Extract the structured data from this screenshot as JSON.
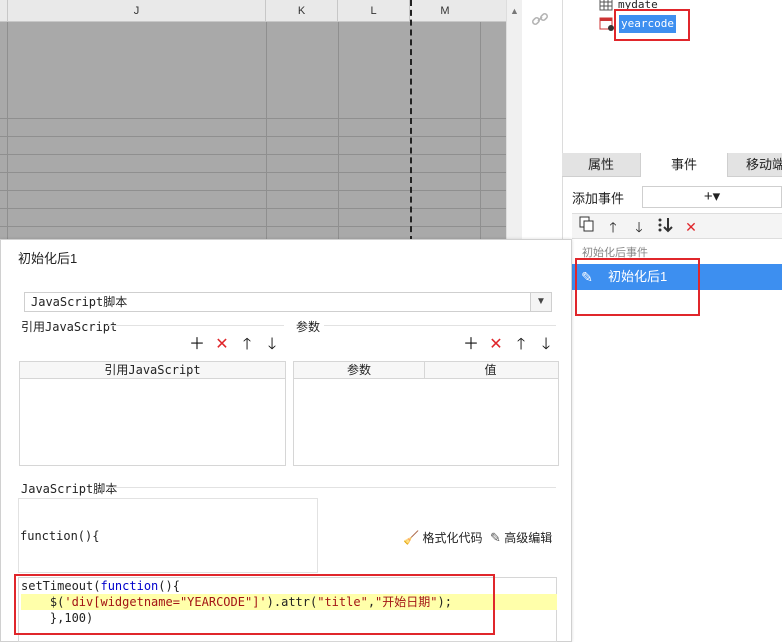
{
  "sheet": {
    "columns": [
      "J",
      "K",
      "L",
      "M"
    ]
  },
  "tree": {
    "items": [
      {
        "label": "mydate"
      },
      {
        "label": "yearcode"
      }
    ]
  },
  "right_panel": {
    "tabs": [
      {
        "label": "属性"
      },
      {
        "label": "事件"
      },
      {
        "label": "移动端"
      }
    ],
    "add_event_label": "添加事件",
    "add_event_symbol": "+▾",
    "event_group_label": "初始化后事件",
    "event_item_label": "初始化后1"
  },
  "dialog": {
    "title": "初始化后1",
    "script_type": "JavaScript脚本",
    "ref_js_label": "引用JavaScript",
    "params_label": "参数",
    "ref_js_table_header": "引用JavaScript",
    "params_table_headers": [
      "参数",
      "值"
    ],
    "script_section_label": "JavaScript脚本",
    "function_header": "function(){",
    "format_code_label": "格式化代码",
    "advanced_edit_label": "高级编辑",
    "code": {
      "line1_kw_a": "setTimeout(",
      "line1_kw_b": "function",
      "line1_rest": "(){",
      "line2_a": "    $(",
      "line2_str1": "'div[widgetname=\"YEARCODE\"]'",
      "line2_b": ").attr(",
      "line2_str2": "\"title\"",
      "line2_c": ",",
      "line2_str3": "\"开始日期\"",
      "line2_d": ");",
      "line3": "    },100)"
    }
  },
  "colors": {
    "accent": "#3d8ff0",
    "highlight_red": "#e0262b",
    "sheet_gray": "#a9a9a9",
    "code_line_highlight": "#ffffaa"
  }
}
